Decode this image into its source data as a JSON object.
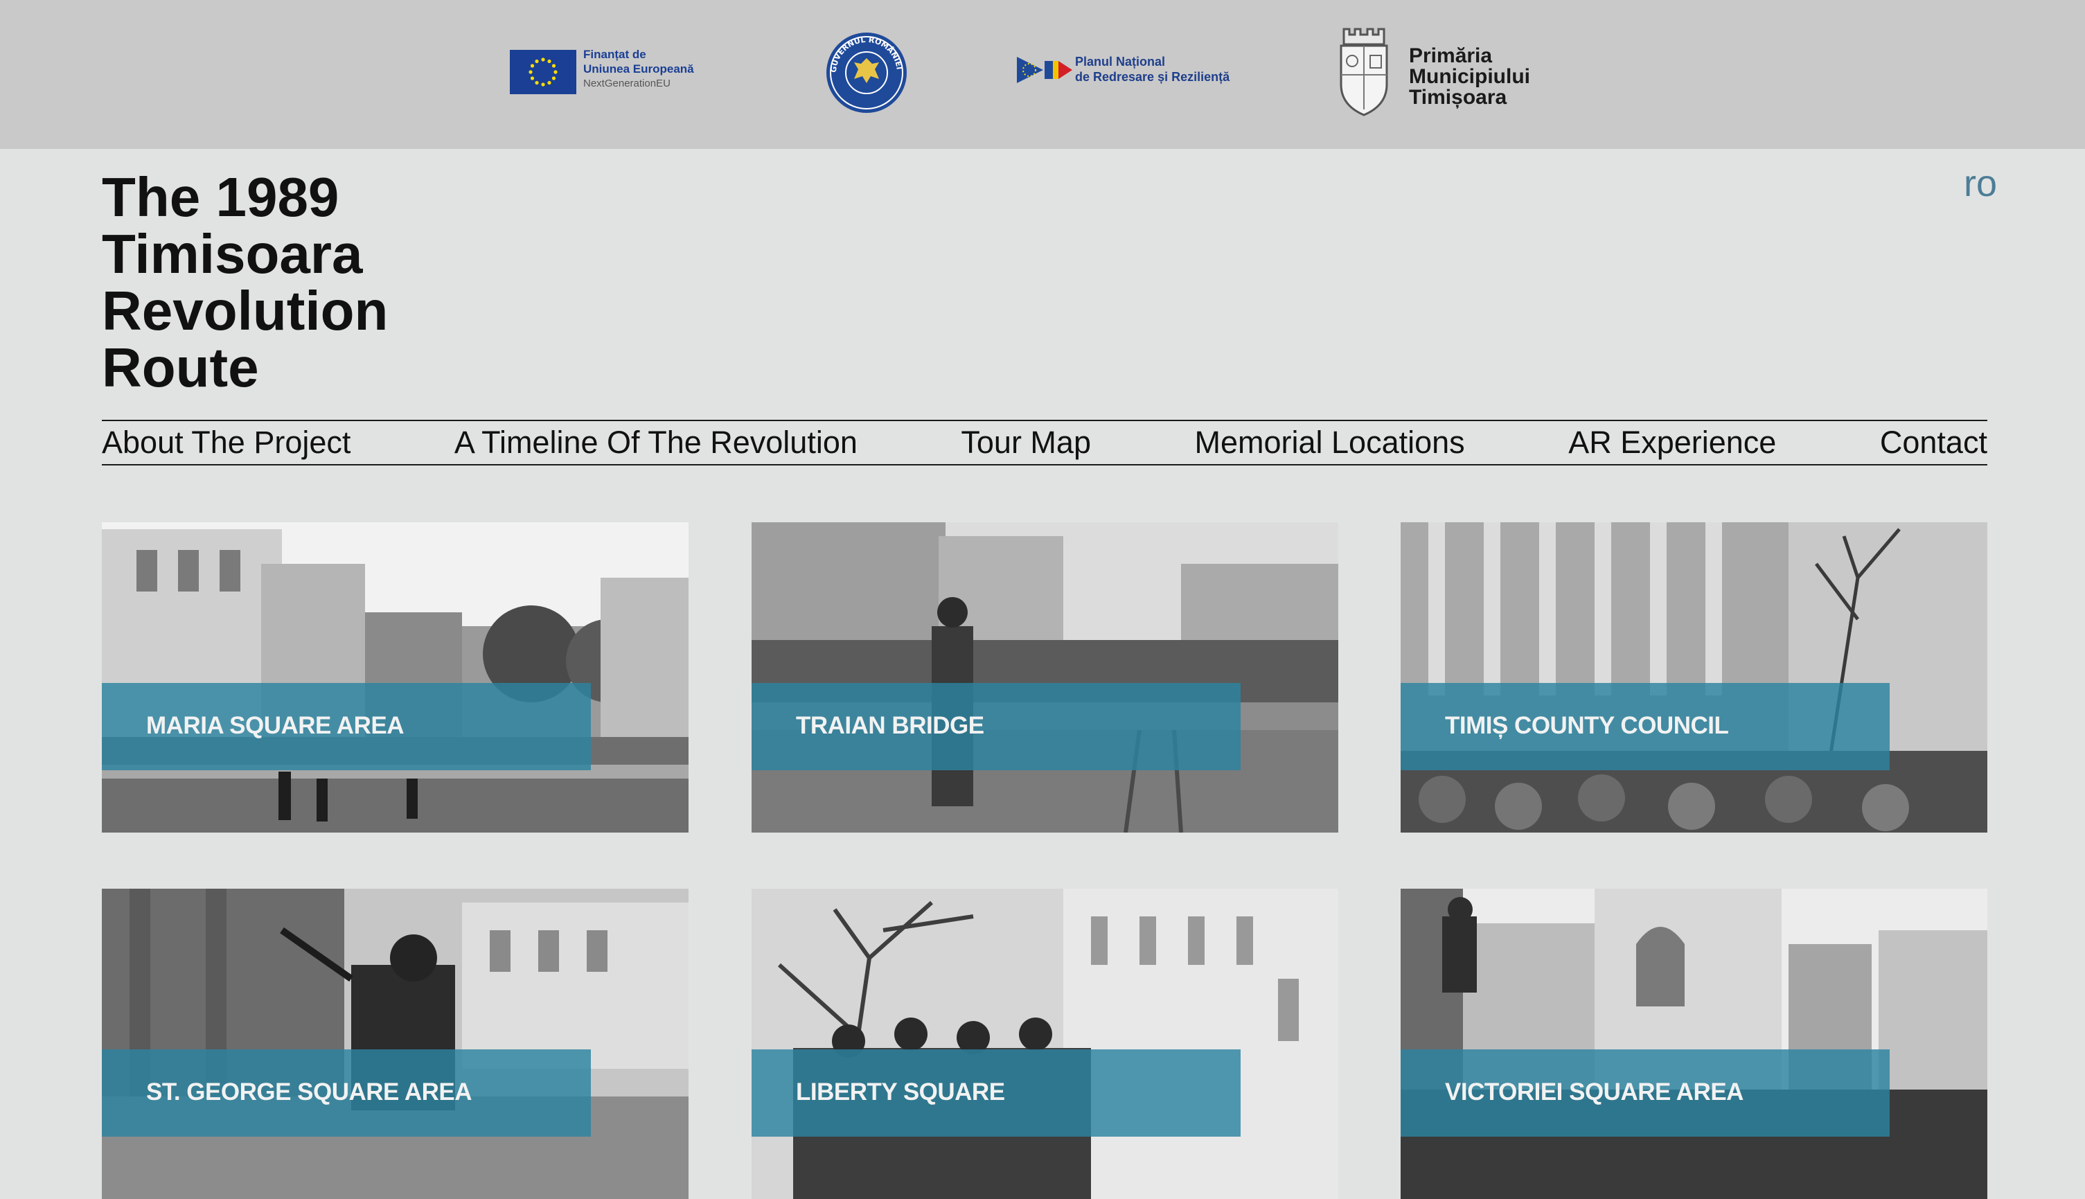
{
  "banner": {
    "eu_line1": "Finanțat de",
    "eu_line2": "Uniunea Europeană",
    "eu_line3": "NextGenerationEU",
    "gov_ring_text": "GUVERNUL ROMÂNIEI",
    "pnrr_line1": "Planul Național",
    "pnrr_line2": "de Redresare și Reziliență",
    "prim_line1": "Primăria",
    "prim_line2": "Municipiului",
    "prim_line3": "Timișoara"
  },
  "header": {
    "title": "The 1989\nTimisoara\nRevolution\nRoute",
    "lang": "ro"
  },
  "nav": {
    "items": [
      "About The Project",
      "A Timeline Of The Revolution",
      "Tour Map",
      "Memorial Locations",
      "AR Experience",
      "Contact"
    ]
  },
  "locations": [
    {
      "label": "MARIA SQUARE AREA"
    },
    {
      "label": "TRAIAN BRIDGE"
    },
    {
      "label": "TIMIȘ COUNTY COUNCIL"
    },
    {
      "label": "ST. GEORGE SQUARE AREA"
    },
    {
      "label": "LIBERTY SQUARE"
    },
    {
      "label": "VICTORIEI SQUARE AREA"
    }
  ],
  "colors": {
    "page_bg": "#e1e3e3",
    "banner_bg": "#c9c9c9",
    "accent_teal": "#2c84a0",
    "lang_link": "#4d7d96"
  }
}
